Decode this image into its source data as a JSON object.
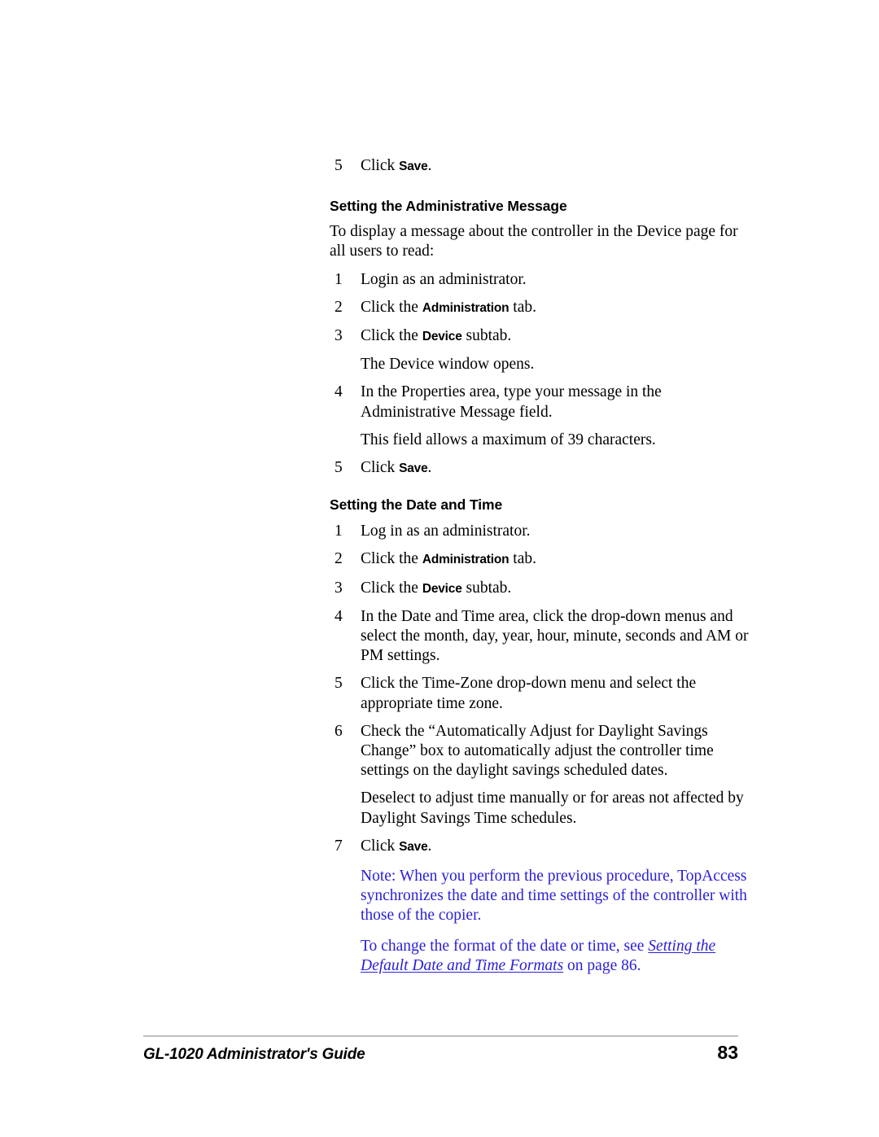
{
  "document": {
    "footer": {
      "title": "GL-1020 Administrator's Guide",
      "page_number": "83"
    },
    "note_color": "#2B20D8"
  },
  "blocks": {
    "top_step": {
      "num": "5",
      "pre": "Click ",
      "ui": "Save",
      "post": "."
    },
    "section_admin_message": {
      "heading": "Setting the Administrative Message",
      "intro": "To display a message about the controller in the Device page for all users to read:",
      "steps": {
        "s1": {
          "num": "1",
          "text": "Login as an administrator."
        },
        "s2": {
          "num": "2",
          "pre": "Click the ",
          "ui": "Administration",
          "post": " tab."
        },
        "s3": {
          "num": "3",
          "pre": "Click the ",
          "ui": "Device",
          "post": " subtab."
        },
        "s3_note": "The Device window opens.",
        "s4": {
          "num": "4",
          "text": "In the Properties area, type your message in the Administrative Message field."
        },
        "s4_note": "This field allows a maximum of 39 characters.",
        "s5": {
          "num": "5",
          "pre": "Click ",
          "ui": "Save",
          "post": "."
        }
      }
    },
    "section_date_time": {
      "heading": "Setting the Date and Time",
      "steps": {
        "s1": {
          "num": "1",
          "text": "Log in as an administrator."
        },
        "s2": {
          "num": "2",
          "pre": "Click the ",
          "ui": "Administration",
          "post": " tab."
        },
        "s3": {
          "num": "3",
          "pre": "Click the ",
          "ui": "Device",
          "post": " subtab."
        },
        "s4": {
          "num": "4",
          "text": "In the Date and Time area, click the drop-down menus and select the month, day, year, hour, minute, seconds and AM or PM settings."
        },
        "s5": {
          "num": "5",
          "text": "Click the Time-Zone drop-down menu and select the appropriate time zone."
        },
        "s6": {
          "num": "6",
          "text": "Check the “Automatically Adjust for Daylight Savings Change” box to automatically adjust the controller time settings on the daylight savings scheduled dates."
        },
        "s6_note": "Deselect to adjust time manually or for areas not affected by Daylight Savings Time schedules.",
        "s7": {
          "num": "7",
          "pre": "Click ",
          "ui": "Save",
          "post": "."
        }
      },
      "note": {
        "paragraph1": "Note: When you perform the previous procedure, TopAccess synchronizes the date and time settings of the controller with those of the copier.",
        "paragraph2_pre": "To change the format of the date or time, see ",
        "paragraph2_link": "Setting the Default Date and Time Formats",
        "paragraph2_post": " on page 86."
      }
    }
  }
}
